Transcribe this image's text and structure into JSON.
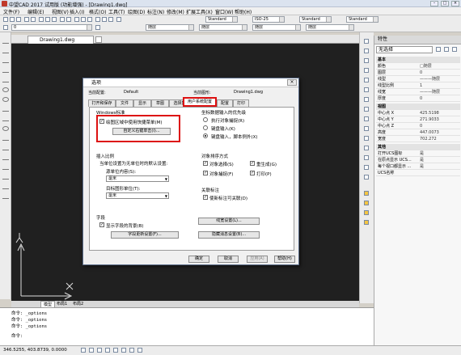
{
  "window": {
    "title": "中望CAD 2017 试用版 (功能增强) - [Drawing1.dwg]"
  },
  "menu": [
    "文件(F)",
    "编辑(E)",
    "视图(V)",
    "插入(I)",
    "格式(O)",
    "工具(T)",
    "绘图(D)",
    "标注(N)",
    "修改(M)",
    "扩展工具(X)",
    "窗口(W)",
    "帮助(H)"
  ],
  "toolbar": {
    "text_style": "Standard",
    "dim_style": "ISO-25",
    "table_style": "Standard",
    "mleader_style": "Standard",
    "layer": "0",
    "color": "随层",
    "linetype": "随层",
    "lineweight": "随层",
    "layer_panel": "随层"
  },
  "tabs": {
    "doc": "Drawing1.dwg"
  },
  "cmd": {
    "tab1": "模型",
    "tab2": "布局1",
    "tab3": "布局2",
    "lines": [
      "命令: _options",
      "命令: _options",
      "命令: _options"
    ],
    "prompt": "命令:"
  },
  "status": {
    "coords": "346.5255, 403.8739, 0.0000"
  },
  "properties": {
    "title": "特性",
    "selection": "无选择",
    "sec_basic": "基本",
    "basic": [
      [
        "颜色",
        "□随层"
      ],
      [
        "图层",
        "0"
      ],
      [
        "线型",
        "———随层"
      ],
      [
        "线型比例",
        "1"
      ],
      [
        "线宽",
        "———随层"
      ],
      [
        "厚度",
        "0"
      ]
    ],
    "sec_view": "视图",
    "view": [
      [
        "中心点 X",
        "425.5198"
      ],
      [
        "中心点 Y",
        "271.9033"
      ],
      [
        "中心点 Z",
        "0"
      ],
      [
        "高度",
        "447.0073"
      ],
      [
        "宽度",
        "702.272"
      ]
    ],
    "sec_misc": "其他",
    "misc": [
      [
        "打开UCS图标",
        "是"
      ],
      [
        "在原点显示 UCS...",
        "是"
      ],
      [
        "每个视口都显示 ...",
        "是"
      ],
      [
        "UCS名称",
        ""
      ]
    ]
  },
  "dialog": {
    "title": "选项",
    "current_profile_label": "当前配置:",
    "current_profile": "Default",
    "current_drawing_label": "当前图形:",
    "current_drawing": "Drawing1.dwg",
    "tabs": [
      "打开和保存",
      "文件",
      "显示",
      "草图",
      "选择集",
      "用户系统配置",
      "配置",
      "打印"
    ],
    "windows_std": "Windows标准",
    "shortcut_menu": "绘图区域中使用快捷菜单(M)",
    "custom_right_click": "自定义右键单击(I)...",
    "coord_input": "坐标数据输入的优先级",
    "coord_opts": [
      "执行对象捕捉(R)",
      "键盘输入(K)",
      "键盘输入，脚本例外(X)"
    ],
    "insert_scale": "插入比例",
    "insert_desc": "当单位设置为无单位时的默认设置:",
    "src_label": "源单位内容(S):",
    "src_value": "毫米",
    "tgt_label": "目标图形单位(T):",
    "tgt_value": "毫米",
    "obj_sort": "对象排序方式",
    "sort_opts": [
      "对象选择(S)",
      "重生成(G)",
      "对象捕捉(F)",
      "打印(P)"
    ],
    "assoc_dim": "关联标注",
    "assoc_opt": "使新标注可关联(D)",
    "fields": "字段",
    "field_bg": "显示字段的背景(B)",
    "field_settings": "字段更新设置(F)...",
    "lineweight_btn": "线宽设置(L)...",
    "hidden_msg_btn": "隐藏消息设置(B)...",
    "ok": "确定",
    "cancel": "取消",
    "apply": "应用(A)",
    "help": "帮助(H)"
  }
}
